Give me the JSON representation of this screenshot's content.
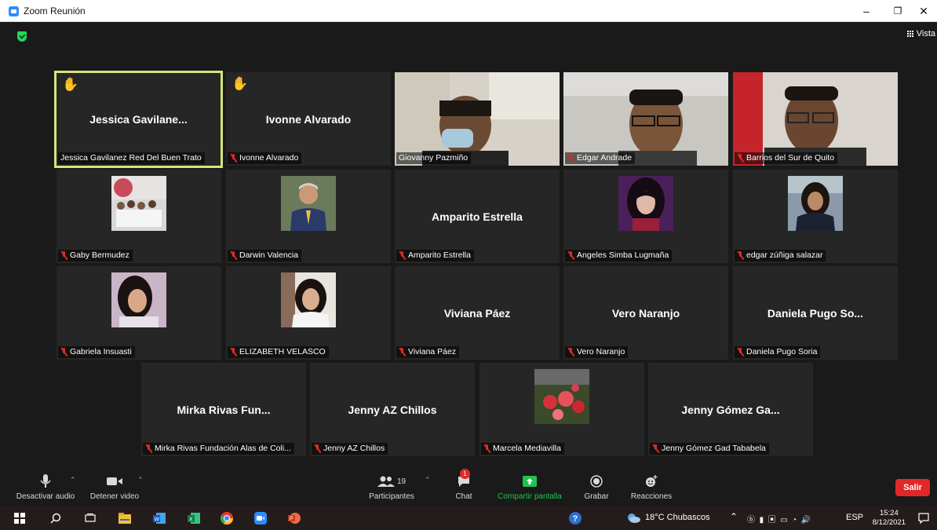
{
  "window": {
    "title": "Zoom Reunión"
  },
  "meeting": {
    "view_label": "Vista",
    "tiles": [
      {
        "center": "Jessica  Gavilane...",
        "label": "Jessica Gavilanez Red Del Buen Trato",
        "muted": false,
        "hand": true
      },
      {
        "center": "Ivonne Alvarado",
        "label": "Ivonne Alvarado",
        "muted": true,
        "hand": true
      },
      {
        "center": "",
        "label": "Giovanny Pazmiño",
        "muted": false
      },
      {
        "center": "",
        "label": "Edgar Andrade",
        "muted": true
      },
      {
        "center": "",
        "label": "Barrios del Sur de Quito",
        "muted": true
      },
      {
        "center": "",
        "label": "Gaby Bermudez",
        "muted": true
      },
      {
        "center": "",
        "label": "Darwin Valencia",
        "muted": true
      },
      {
        "center": "Amparito Estrella",
        "label": "Amparito Estrella",
        "muted": true
      },
      {
        "center": "",
        "label": "Angeles Simba Lugmaña",
        "muted": true
      },
      {
        "center": "",
        "label": "edgar zúñiga salazar",
        "muted": true
      },
      {
        "center": "",
        "label": "Gabriela Insuasti",
        "muted": true
      },
      {
        "center": "",
        "label": "ELIZABETH VELASCO",
        "muted": true
      },
      {
        "center": "Viviana Páez",
        "label": "Viviana Páez",
        "muted": true
      },
      {
        "center": "Vero Naranjo",
        "label": "Vero Naranjo",
        "muted": true
      },
      {
        "center": "Daniela  Pugo  So...",
        "label": "Daniela Pugo Soria",
        "muted": true
      },
      {
        "center": "Mirka  Rivas  Fun...",
        "label": "Mirka Rivas Fundación Alas de Coli...",
        "muted": true
      },
      {
        "center": "Jenny AZ Chillos",
        "label": "Jenny AZ Chillos",
        "muted": true
      },
      {
        "center": "",
        "label": "Marcela Mediavilla",
        "muted": true
      },
      {
        "center": "Jenny  Gómez  Ga...",
        "label": "Jenny Gómez Gad Tababela",
        "muted": true
      }
    ]
  },
  "toolbar": {
    "mute_label": "Desactivar audio",
    "video_label": "Detener video",
    "participants_label": "Participantes",
    "participants_count": "19",
    "chat_label": "Chat",
    "chat_badge": "1",
    "share_label": "Compartir pantalla",
    "record_label": "Grabar",
    "reactions_label": "Reacciones",
    "leave_label": "Salir"
  },
  "taskbar": {
    "weather": "18°C  Chubascos",
    "language": "ESP",
    "time": "15:24",
    "date": "8/12/2021"
  }
}
